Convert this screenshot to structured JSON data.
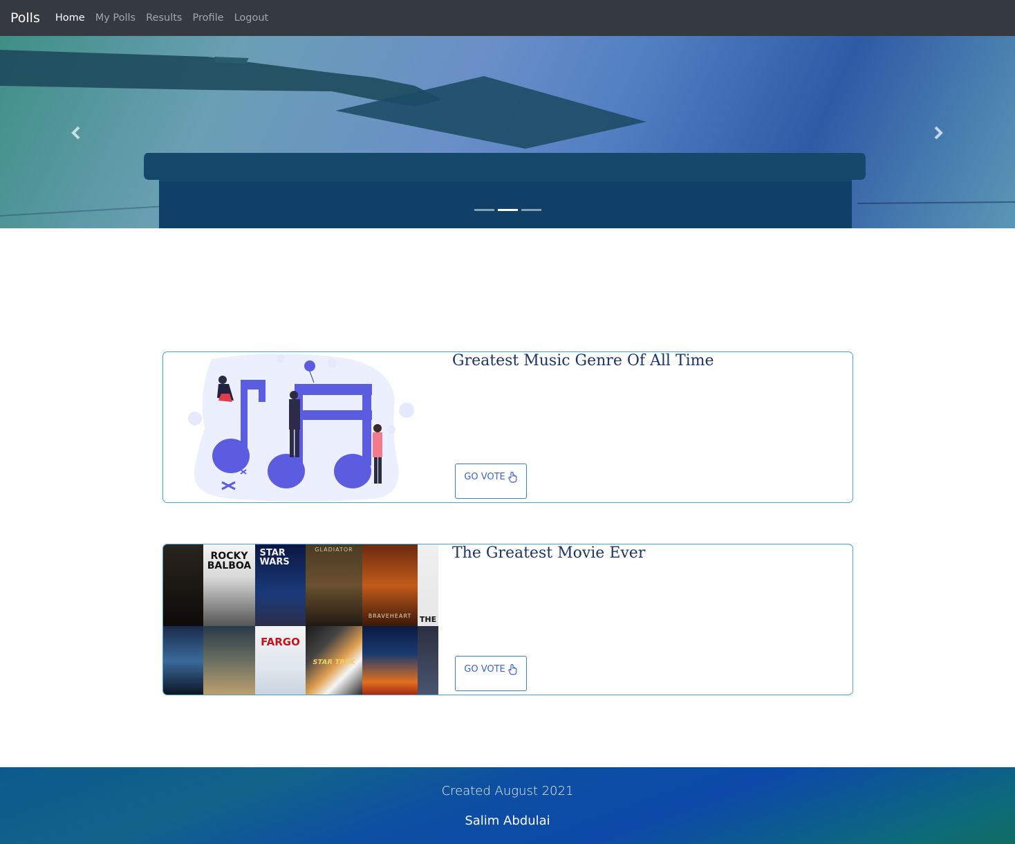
{
  "navbar": {
    "brand": "Polls",
    "links": [
      "Home",
      "My Polls",
      "Results",
      "Profile",
      "Logout"
    ],
    "active": "Home"
  },
  "carousel": {
    "slide_count": 3,
    "active_index": 1,
    "prev_icon": "chevron-left-icon",
    "next_icon": "chevron-right-icon"
  },
  "polls": [
    {
      "title": "Greatest Music Genre Of All Time",
      "button_label": "GO VOTE",
      "button_icon": "hand-pointer-icon",
      "image": "music-notes-illustration"
    },
    {
      "title": "The Greatest Movie Ever",
      "button_label": "GO VOTE",
      "button_icon": "hand-pointer-icon",
      "image": "movie-posters-collage"
    }
  ],
  "posters": [
    "ROCKY BALBOA",
    "STAR WARS",
    "GLADIATOR",
    "BRAVEHEART",
    "THE",
    "FARGO",
    "STAR TREK"
  ],
  "footer": {
    "created": "Created August 2021",
    "author": "Salim Abdulai"
  },
  "colors": {
    "navbar": "#343a40",
    "card_border": "#4aa3d6",
    "title": "#1d3363",
    "button": "#3b63c7"
  }
}
